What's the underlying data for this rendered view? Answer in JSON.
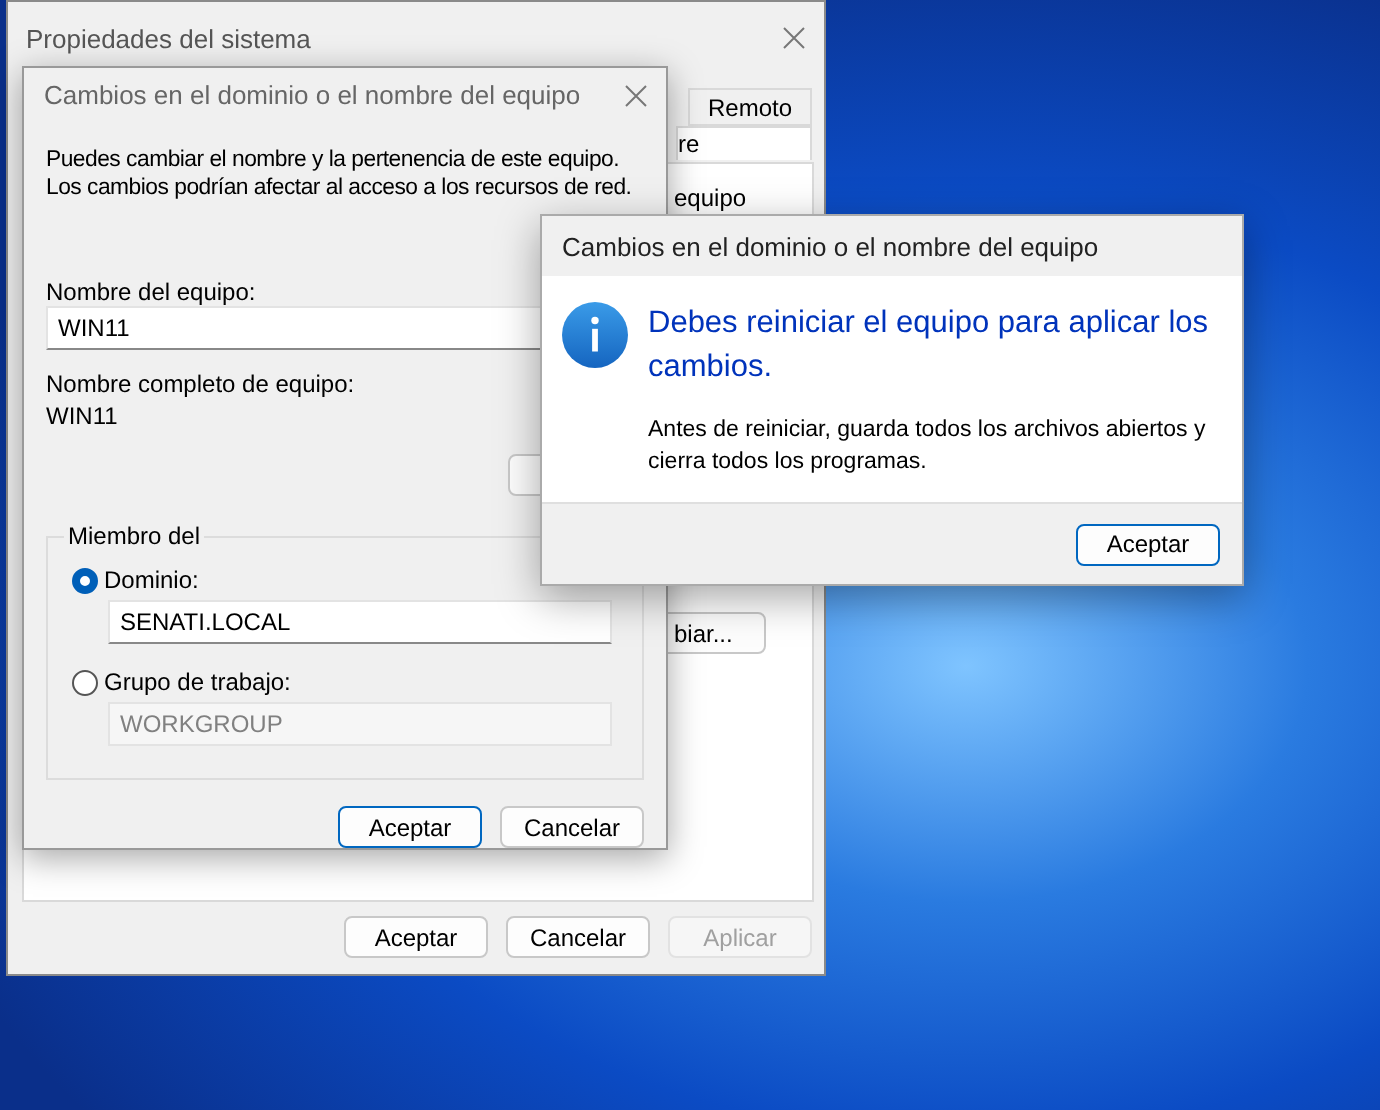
{
  "system_properties": {
    "title": "Propiedades del sistema",
    "tabs": [
      {
        "label": "Remoto",
        "selected": false
      },
      {
        "label": "re",
        "selected": true
      }
    ],
    "panel_fragment": "equipo",
    "change_button": "biar...",
    "buttons": [
      {
        "label": "Aceptar",
        "disabled": false
      },
      {
        "label": "Cancelar",
        "disabled": false
      },
      {
        "label": "Aplicar",
        "disabled": true
      }
    ]
  },
  "domain_dialog": {
    "title": "Cambios en el dominio o el nombre del equipo",
    "description": "Puedes cambiar el nombre y la pertenencia de este equipo. Los cambios podrían afectar al acceso a los recursos de red.",
    "computer_name_label": "Nombre del equipo:",
    "computer_name": "WIN11",
    "full_name_label": "Nombre completo de equipo:",
    "full_name": "WIN11",
    "member_of": {
      "label": "Miembro del",
      "options": [
        {
          "label": "Dominio:",
          "selected": true,
          "value": "SENATI.LOCAL"
        },
        {
          "label": "Grupo de trabajo:",
          "selected": false,
          "value": "WORKGROUP"
        }
      ]
    },
    "buttons": [
      {
        "label": "Aceptar",
        "default": true
      },
      {
        "label": "Cancelar",
        "default": false
      }
    ]
  },
  "message_box": {
    "title": "Cambios en el dominio o el nombre del equipo",
    "heading": "Debes reiniciar el equipo para aplicar los cambios.",
    "body": "Antes de reiniciar, guarda todos los archivos abiertos y cierra todos los programas.",
    "button": "Aceptar"
  }
}
